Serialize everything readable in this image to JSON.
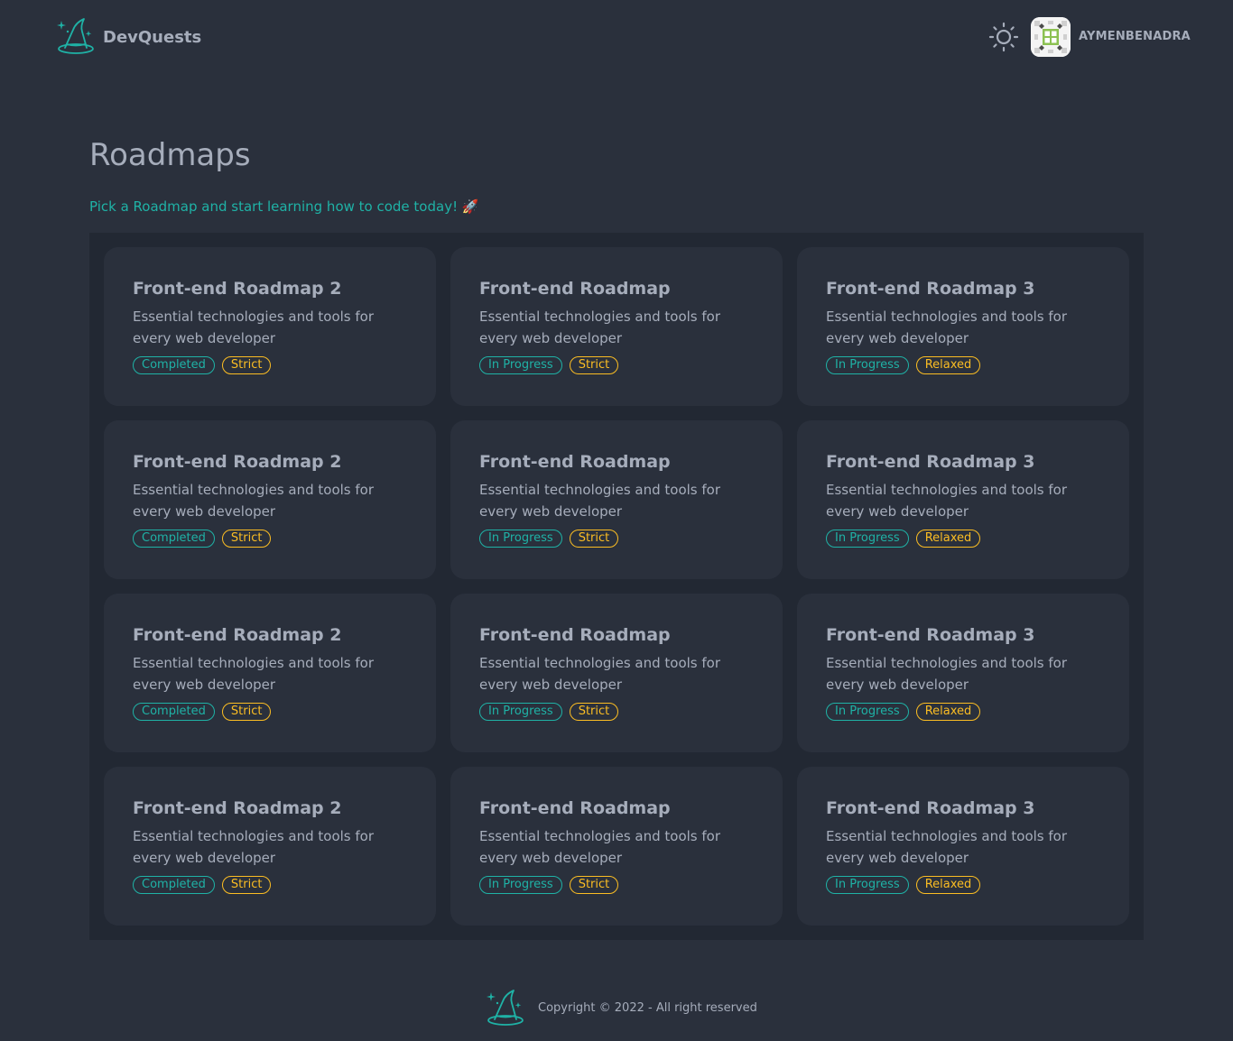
{
  "header": {
    "brand_name": "DevQuests",
    "username": "AYMENBENADRA",
    "theme_icon": "sun-icon",
    "brand_icon": "wizard-hat-icon"
  },
  "main": {
    "title": "Roadmaps",
    "subtitle": "Pick a Roadmap and start learning how to code today!",
    "subtitle_emoji": "🚀",
    "cards": [
      {
        "title": "Front-end Roadmap 2",
        "description": "Essential technologies and tools for every web developer",
        "status": "Completed",
        "mode": "Strict"
      },
      {
        "title": "Front-end Roadmap",
        "description": "Essential technologies and tools for every web developer",
        "status": "In Progress",
        "mode": "Strict"
      },
      {
        "title": "Front-end Roadmap 3",
        "description": "Essential technologies and tools for every web developer",
        "status": "In Progress",
        "mode": "Relaxed"
      },
      {
        "title": "Front-end Roadmap 2",
        "description": "Essential technologies and tools for every web developer",
        "status": "Completed",
        "mode": "Strict"
      },
      {
        "title": "Front-end Roadmap",
        "description": "Essential technologies and tools for every web developer",
        "status": "In Progress",
        "mode": "Strict"
      },
      {
        "title": "Front-end Roadmap 3",
        "description": "Essential technologies and tools for every web developer",
        "status": "In Progress",
        "mode": "Relaxed"
      },
      {
        "title": "Front-end Roadmap 2",
        "description": "Essential technologies and tools for every web developer",
        "status": "Completed",
        "mode": "Strict"
      },
      {
        "title": "Front-end Roadmap",
        "description": "Essential technologies and tools for every web developer",
        "status": "In Progress",
        "mode": "Strict"
      },
      {
        "title": "Front-end Roadmap 3",
        "description": "Essential technologies and tools for every web developer",
        "status": "In Progress",
        "mode": "Relaxed"
      },
      {
        "title": "Front-end Roadmap 2",
        "description": "Essential technologies and tools for every web developer",
        "status": "Completed",
        "mode": "Strict"
      },
      {
        "title": "Front-end Roadmap",
        "description": "Essential technologies and tools for every web developer",
        "status": "In Progress",
        "mode": "Strict"
      },
      {
        "title": "Front-end Roadmap 3",
        "description": "Essential technologies and tools for every web developer",
        "status": "In Progress",
        "mode": "Relaxed"
      }
    ]
  },
  "footer": {
    "copyright": "Copyright © 2022 - All right reserved"
  },
  "colors": {
    "background": "#2a303c",
    "panel": "#222833",
    "text": "#a6adbb",
    "accent": "#1fb2a6",
    "warning": "#fbbd23"
  }
}
